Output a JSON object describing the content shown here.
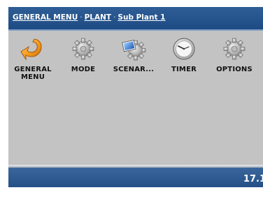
{
  "breadcrumb": {
    "items": [
      "GENERAL MENU",
      "PLANT",
      "Sub Plant 1"
    ],
    "separator": "·"
  },
  "menu": {
    "items": [
      {
        "label": "GENERAL\nMENU",
        "icon": "back-arrow-icon"
      },
      {
        "label": "MODE",
        "icon": "gear-icon"
      },
      {
        "label": "SCENAR...",
        "icon": "scenario-gear-icon"
      },
      {
        "label": "TIMER",
        "icon": "clock-icon"
      },
      {
        "label": "OPTIONS",
        "icon": "gear-icon"
      }
    ]
  },
  "status": {
    "time": "17.1"
  },
  "colors": {
    "header_blue": "#1d4a82",
    "panel_gray": "#c3c3c3",
    "arrow_orange": "#f29a1e"
  }
}
